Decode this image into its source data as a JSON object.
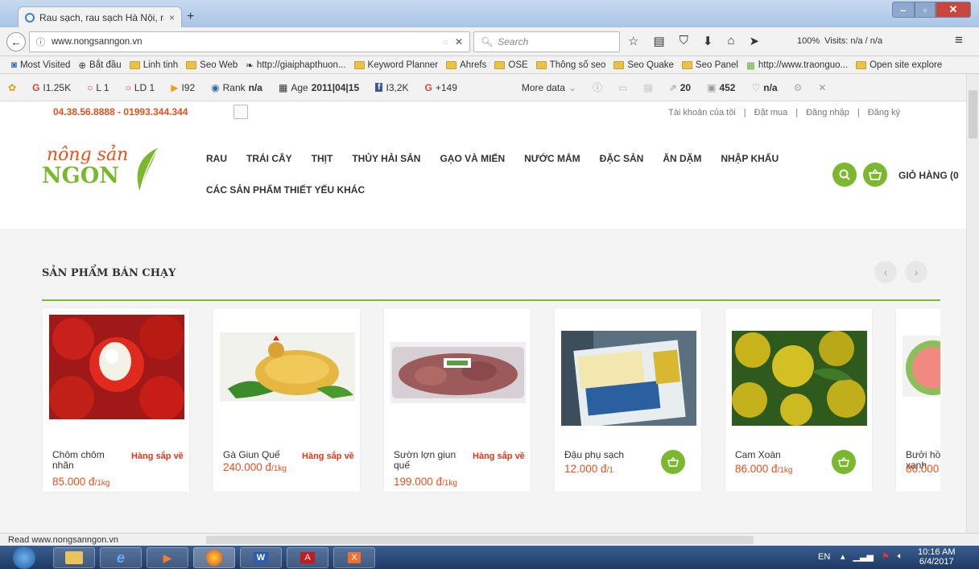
{
  "browser": {
    "tab_title": "Rau sạch, rau sạch Hà Nội, ra",
    "url": "www.nongsanngon.vn",
    "search_placeholder": "Search",
    "zoom": "100%",
    "visits": "Visits: n/a / n/a"
  },
  "bookmarks": [
    "Most Visited",
    "Bắt đầu",
    "Linh tinh",
    "Seo Web",
    "http://giaiphapthuon...",
    "Keyword Planner",
    "Ahrefs",
    "OSE",
    "Thông số seo",
    "Seo Quake",
    "Seo Panel",
    "http://www.traonguo...",
    "Open site explore"
  ],
  "seo": {
    "g": "I1.25K",
    "l": "L 1",
    "ld": "LD 1",
    "b": "I92",
    "rank_label": "Rank",
    "rank": "n/a",
    "age_label": "Age",
    "age": "2011|04|15",
    "fb": "I3,2K",
    "gplus": "+149",
    "more": "More data",
    "m1": "20",
    "m2": "452",
    "m3": "n/a"
  },
  "site": {
    "phone": "04.38.56.8888 - 01993.344.344",
    "account": "Tài khoản của tôi",
    "order": "Đặt mua",
    "login": "Đăng nhập",
    "register": "Đăng ký",
    "logo_top": "nông sản",
    "logo_bottom": "NGON",
    "menu": [
      "RAU",
      "TRÁI CÂY",
      "THỊT",
      "THỦY HẢI SẢN",
      "GẠO VÀ MIẾN",
      "NƯỚC MẮM",
      "ĐẶC SẢN",
      "ĂN DẶM",
      "NHẬP KHẨU"
    ],
    "menu2": "CÁC SẢN PHẨM THIẾT YẾU KHÁC",
    "cart": "GIỎ HÀNG (0",
    "section_title": "SẢN PHẨM BÁN CHẠY"
  },
  "products": [
    {
      "name": "Chôm chôm nhãn",
      "status": "Hàng sắp về",
      "price": "85.000 đ",
      "unit": "/1kg"
    },
    {
      "name": "Gà Giun Quế",
      "status": "Hàng sắp về",
      "price": "240.000 đ",
      "unit": "/1kg"
    },
    {
      "name": "Sườn lợn giun quế",
      "status": "Hàng sắp về",
      "price": "199.000 đ",
      "unit": "/1kg"
    },
    {
      "name": "Đậu phụ sạch",
      "status": "",
      "price": "12.000 đ",
      "unit": "/1"
    },
    {
      "name": "Cam Xoàn",
      "status": "",
      "price": "86.000 đ",
      "unit": "/1kg"
    },
    {
      "name": "Bưởi hồ xanh",
      "status": "",
      "price": "86.000",
      "unit": ""
    }
  ],
  "status_bar": "Read www.nongsanngon.vn",
  "taskbar": {
    "lang": "EN",
    "time": "10:16 AM",
    "date": "6/4/2017"
  },
  "colors": {
    "accent": "#7cb82f",
    "price": "#e8501c",
    "status": "#e0361a"
  }
}
